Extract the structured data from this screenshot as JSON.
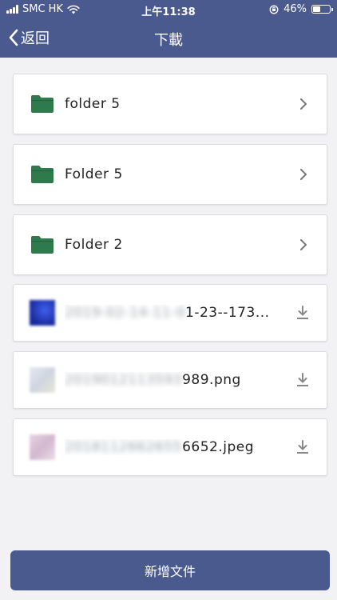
{
  "status_bar": {
    "carrier": "SMC HK",
    "time": "上午11:38",
    "battery": "46%",
    "battery_level": 0.46
  },
  "nav": {
    "back_label": "返回",
    "title": "下載"
  },
  "items": [
    {
      "type": "folder",
      "name": "folder 5"
    },
    {
      "type": "folder",
      "name": "Folder 5"
    },
    {
      "type": "folder",
      "name": "Folder 2"
    },
    {
      "type": "file",
      "name_hidden": "2019-02-14-11-0",
      "name_visible": "1-23--173...",
      "thumb_color": "#2a3ccf"
    },
    {
      "type": "file",
      "name_hidden": "2019012113593",
      "name_visible": "989.png",
      "thumb_color": "#d7dce6"
    },
    {
      "type": "file",
      "name_hidden": "2018112662655",
      "name_visible": "6652.jpeg",
      "thumb_color": "#d9c3d6"
    }
  ],
  "footer": {
    "add_file_label": "新增文件"
  },
  "colors": {
    "header": "#4a5a8f",
    "folder": "#2f7a4c",
    "icon_gray": "#888888"
  }
}
